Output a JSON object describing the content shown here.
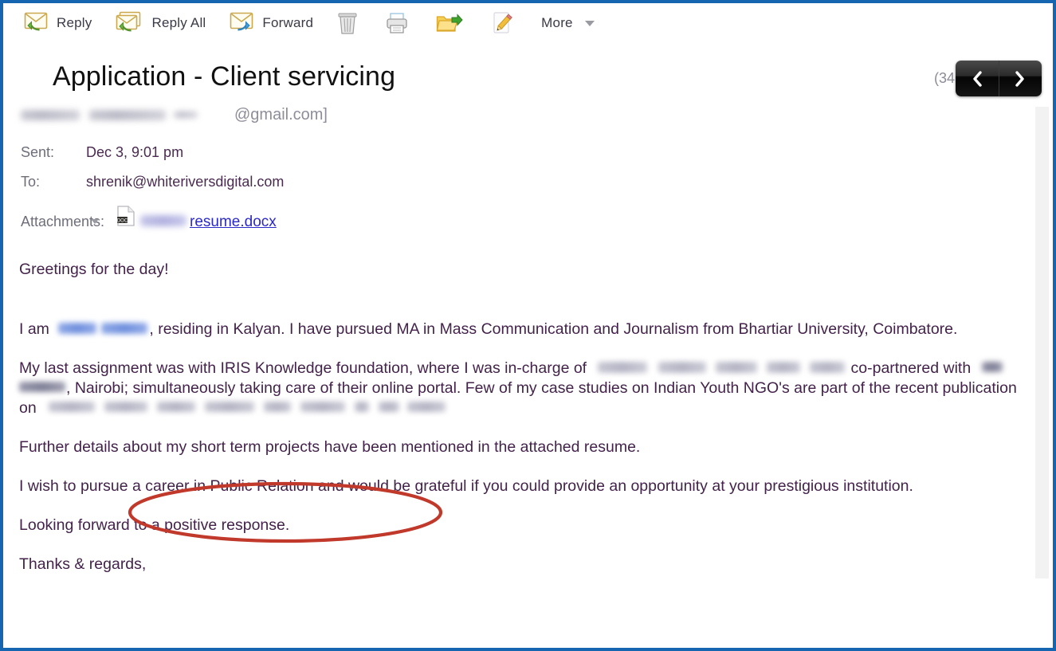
{
  "window": {
    "frame_color": "#1565b0"
  },
  "toolbar": {
    "items": [
      {
        "label": "Reply",
        "icon": "reply-icon"
      },
      {
        "label": "Reply All",
        "icon": "reply-all-icon"
      },
      {
        "label": "Forward",
        "icon": "forward-icon"
      }
    ],
    "icon_buttons": [
      {
        "icon": "trash-icon",
        "title": "Delete"
      },
      {
        "icon": "print-icon",
        "title": "Print"
      },
      {
        "icon": "folder-move-icon",
        "title": "Move"
      },
      {
        "icon": "edit-pencil-icon",
        "title": "Edit"
      }
    ],
    "more_label": "More"
  },
  "header": {
    "subject": "Application - Client servicing",
    "size_label": "(34 k)",
    "prev_title": "Previous message",
    "next_title": "Next message"
  },
  "message": {
    "from_redacted": true,
    "from_domain": "@gmail.com]",
    "sent_label": "Sent:",
    "sent_value": "Dec 3, 9:01 pm",
    "to_label": "To:",
    "to_value": "shrenik@whiteriversdigital.com",
    "attachments_label": "Attachments:",
    "attachment_name": "resume.docx",
    "attachment_prefix_redacted": true
  },
  "body": {
    "greeting": "Greetings for the day!",
    "p1_before": "I am",
    "p1_after": ", residing in Kalyan. I have pursued MA in Mass Communication and Journalism from Bhartiar University, Coimbatore.",
    "p2_a": "My last assignment was with IRIS Knowledge foundation, where I was in-charge of",
    "p2_b": "co-partnered with",
    "p2_c": ", Nairobi; simultaneously taking care of their online portal. Few of my case studies on Indian Youth NGO's are part of the recent publication on",
    "p3": "Further details about my short term projects have been mentioned in the attached resume.",
    "p4": "I wish to pursue a career in Public Relation and would be grateful if you could provide an opportunity at your prestigious institution.",
    "p5": "Looking forward to a positive response.",
    "p6": "Thanks & regards,"
  },
  "annotation": {
    "type": "ellipse",
    "color": "#c0392b",
    "stroke_width": 4,
    "encircles": "I wish to pursue a career in Public Relation and would"
  }
}
